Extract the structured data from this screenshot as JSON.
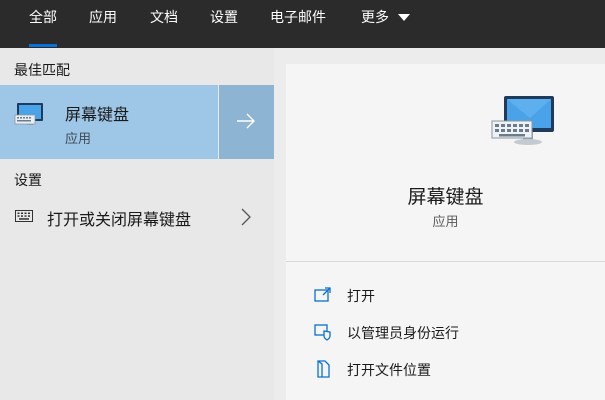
{
  "tabs": [
    {
      "label": "全部",
      "active": true
    },
    {
      "label": "应用",
      "active": false
    },
    {
      "label": "文档",
      "active": false
    },
    {
      "label": "设置",
      "active": false
    },
    {
      "label": "电子邮件",
      "active": false
    },
    {
      "label": "更多",
      "active": false
    }
  ],
  "best_match": {
    "heading": "最佳匹配",
    "title": "屏幕键盘",
    "subtitle": "应用"
  },
  "settings": {
    "heading": "设置",
    "items": [
      {
        "label": "打开或关闭屏幕键盘"
      }
    ]
  },
  "preview": {
    "title": "屏幕键盘",
    "subtitle": "应用",
    "actions": [
      {
        "label": "打开",
        "icon": "open-window-icon"
      },
      {
        "label": "以管理员身份运行",
        "icon": "shield-icon"
      },
      {
        "label": "打开文件位置",
        "icon": "file-location-icon"
      }
    ]
  },
  "colors": {
    "accent": "#0a6fd6",
    "selected": "#9ec6e6",
    "topbar": "#2b2b2b"
  }
}
